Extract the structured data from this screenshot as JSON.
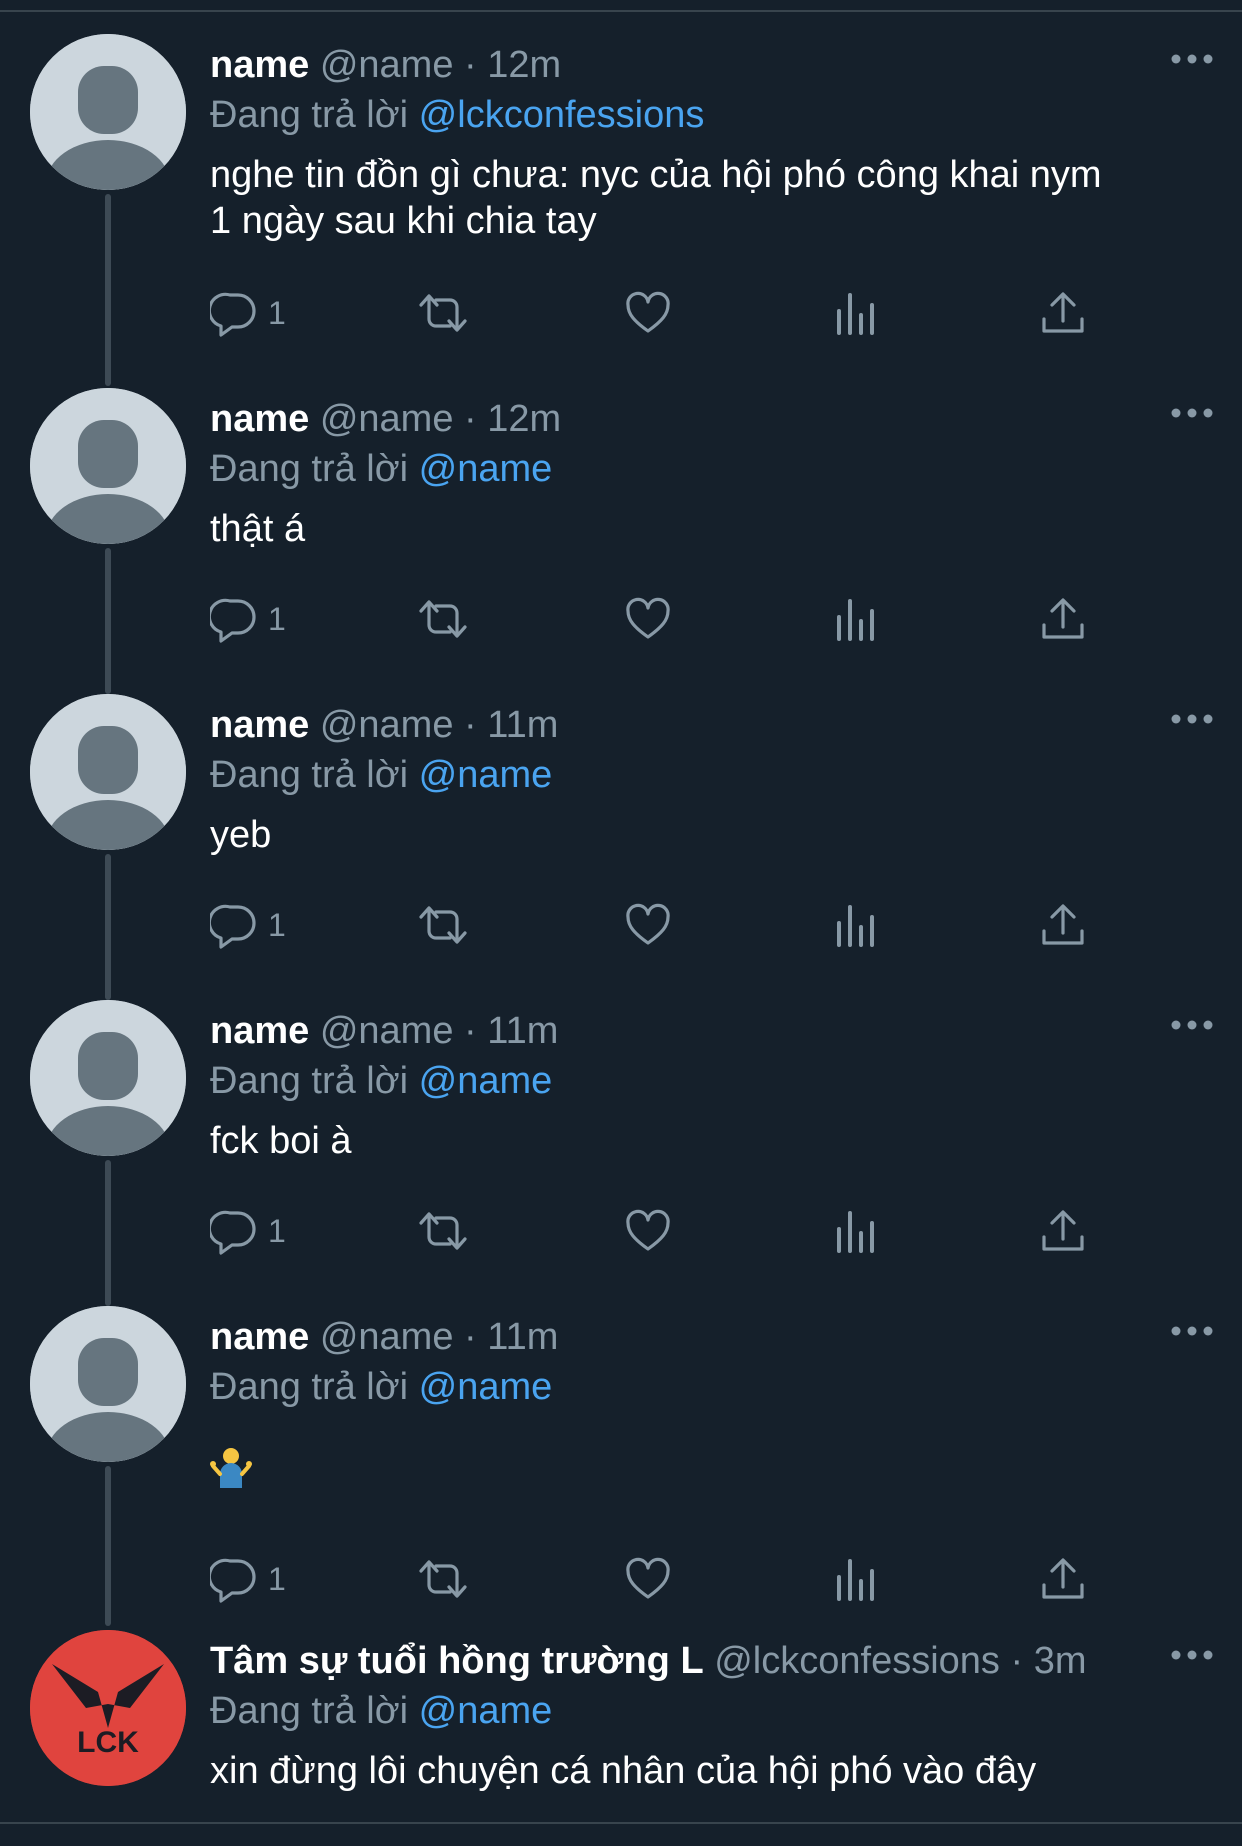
{
  "replying_prefix": "Đang trả lời",
  "tweets": [
    {
      "display_name": "name",
      "handle": "@name",
      "time": "12m",
      "replying_to": "@lckconfessions",
      "text_lines": [
        "nghe tin đồn gì chưa: nyc của hội phó công khai nym",
        "1 ngày sau khi chia tay"
      ],
      "reply_count": "1"
    },
    {
      "display_name": "name",
      "handle": "@name",
      "time": "12m",
      "replying_to": "@name",
      "text_lines": [
        "thật á"
      ],
      "reply_count": "1"
    },
    {
      "display_name": "name",
      "handle": "@name",
      "time": "11m",
      "replying_to": "@name",
      "text_lines": [
        "yeb"
      ],
      "reply_count": "1"
    },
    {
      "display_name": "name",
      "handle": "@name",
      "time": "11m",
      "replying_to": "@name",
      "text_lines": [
        "fck boi à"
      ],
      "reply_count": "1"
    },
    {
      "display_name": "name",
      "handle": "@name",
      "time": "11m",
      "replying_to": "@name",
      "text_lines": [],
      "emoji": "person-shrugging",
      "reply_count": "1"
    },
    {
      "display_name": "Tâm sự tuổi hồng trường L",
      "handle": "@lckconfessions",
      "time": "3m",
      "replying_to": "@name",
      "text_lines": [
        "xin đừng lôi chuyện cá nhân của hội phó vào đây"
      ],
      "avatar": "lck-logo",
      "avatar_text": "LCK"
    }
  ],
  "icons": [
    "reply-icon",
    "retweet-icon",
    "like-icon",
    "views-icon",
    "share-icon",
    "more-icon"
  ],
  "colors": {
    "background": "#15202b",
    "secondary_text": "#8899a6",
    "mention": "#4aa4f0",
    "avatar_default": "#ccd6dd",
    "lck_avatar": "#e0443e"
  }
}
